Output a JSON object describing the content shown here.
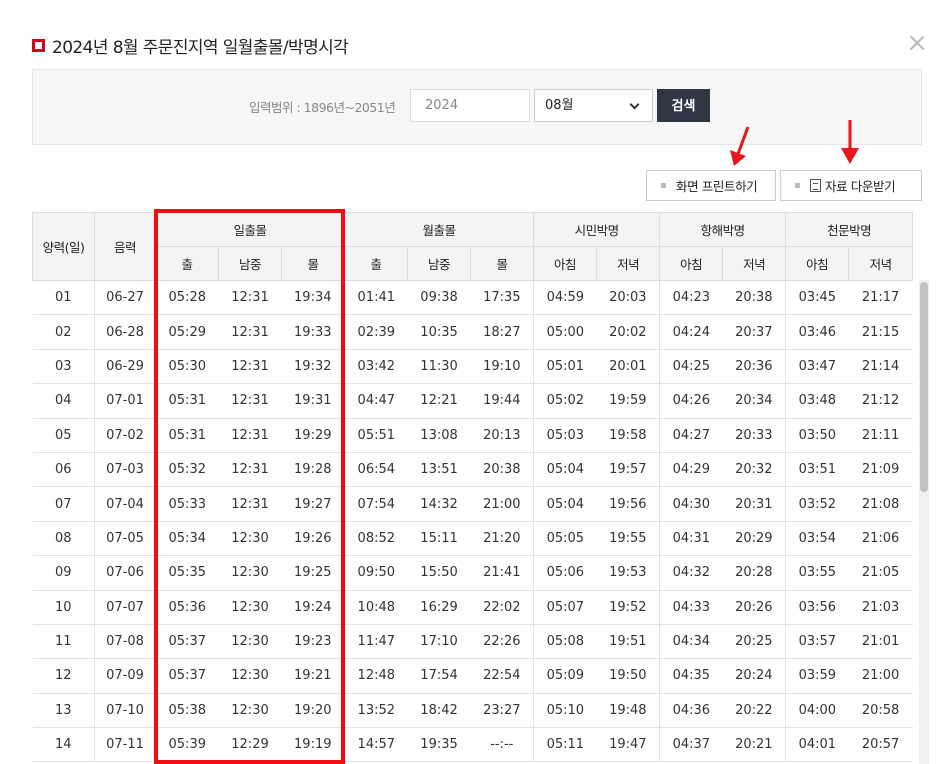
{
  "title": "2024년 8월 주문진지역 일월출몰/박명시각",
  "close_label": "×",
  "search": {
    "range_label": "입력범위 : 1896년~2051년",
    "year_value": "2024",
    "month_value": "08월",
    "button_label": "검색"
  },
  "tools": {
    "print_label": "화면 프린트하기",
    "download_label": "자료 다운받기"
  },
  "colors": {
    "highlight": "#f00d0d",
    "arrow": "#e8151b",
    "search_button": "#2f3644",
    "title_mark": "#d6001c"
  },
  "icons": [
    "close-icon",
    "chevron-down-icon",
    "document-icon",
    "arrow-down-icon"
  ],
  "table": {
    "group_headers": {
      "solar_day": "양력(일)",
      "lunar": "음력",
      "sun": "일출몰",
      "moon": "월출몰",
      "civil": "시민박명",
      "nautical": "항해박명",
      "astronomical": "천문박명"
    },
    "sub_headers": [
      "출",
      "남중",
      "몰",
      "출",
      "남중",
      "몰",
      "아침",
      "저녁",
      "아침",
      "저녁",
      "아침",
      "저녁"
    ],
    "rows": [
      [
        "01",
        "06-27",
        "05:28",
        "12:31",
        "19:34",
        "01:41",
        "09:38",
        "17:35",
        "04:59",
        "20:03",
        "04:23",
        "20:38",
        "03:45",
        "21:17"
      ],
      [
        "02",
        "06-28",
        "05:29",
        "12:31",
        "19:33",
        "02:39",
        "10:35",
        "18:27",
        "05:00",
        "20:02",
        "04:24",
        "20:37",
        "03:46",
        "21:15"
      ],
      [
        "03",
        "06-29",
        "05:30",
        "12:31",
        "19:32",
        "03:42",
        "11:30",
        "19:10",
        "05:01",
        "20:01",
        "04:25",
        "20:36",
        "03:47",
        "21:14"
      ],
      [
        "04",
        "07-01",
        "05:31",
        "12:31",
        "19:31",
        "04:47",
        "12:21",
        "19:44",
        "05:02",
        "19:59",
        "04:26",
        "20:34",
        "03:48",
        "21:12"
      ],
      [
        "05",
        "07-02",
        "05:31",
        "12:31",
        "19:29",
        "05:51",
        "13:08",
        "20:13",
        "05:03",
        "19:58",
        "04:27",
        "20:33",
        "03:50",
        "21:11"
      ],
      [
        "06",
        "07-03",
        "05:32",
        "12:31",
        "19:28",
        "06:54",
        "13:51",
        "20:38",
        "05:04",
        "19:57",
        "04:29",
        "20:32",
        "03:51",
        "21:09"
      ],
      [
        "07",
        "07-04",
        "05:33",
        "12:31",
        "19:27",
        "07:54",
        "14:32",
        "21:00",
        "05:04",
        "19:56",
        "04:30",
        "20:31",
        "03:52",
        "21:08"
      ],
      [
        "08",
        "07-05",
        "05:34",
        "12:30",
        "19:26",
        "08:52",
        "15:11",
        "21:20",
        "05:05",
        "19:55",
        "04:31",
        "20:29",
        "03:54",
        "21:06"
      ],
      [
        "09",
        "07-06",
        "05:35",
        "12:30",
        "19:25",
        "09:50",
        "15:50",
        "21:41",
        "05:06",
        "19:53",
        "04:32",
        "20:28",
        "03:55",
        "21:05"
      ],
      [
        "10",
        "07-07",
        "05:36",
        "12:30",
        "19:24",
        "10:48",
        "16:29",
        "22:02",
        "05:07",
        "19:52",
        "04:33",
        "20:26",
        "03:56",
        "21:03"
      ],
      [
        "11",
        "07-08",
        "05:37",
        "12:30",
        "19:23",
        "11:47",
        "17:10",
        "22:26",
        "05:08",
        "19:51",
        "04:34",
        "20:25",
        "03:57",
        "21:01"
      ],
      [
        "12",
        "07-09",
        "05:37",
        "12:30",
        "19:21",
        "12:48",
        "17:54",
        "22:54",
        "05:09",
        "19:50",
        "04:35",
        "20:24",
        "03:59",
        "21:00"
      ],
      [
        "13",
        "07-10",
        "05:38",
        "12:30",
        "19:20",
        "13:52",
        "18:42",
        "23:27",
        "05:10",
        "19:48",
        "04:36",
        "20:22",
        "04:00",
        "20:58"
      ],
      [
        "14",
        "07-11",
        "05:39",
        "12:29",
        "19:19",
        "14:57",
        "19:35",
        "--:--",
        "05:11",
        "19:47",
        "04:37",
        "20:21",
        "04:01",
        "20:57"
      ]
    ]
  }
}
